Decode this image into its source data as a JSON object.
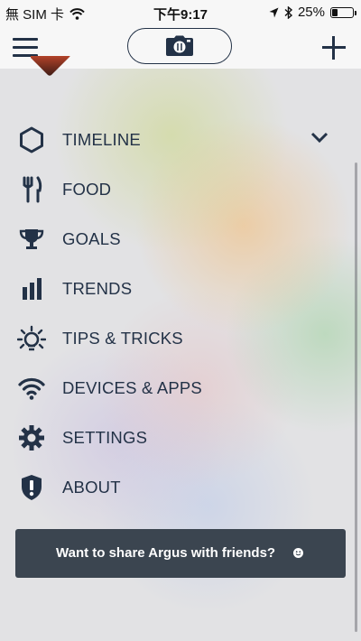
{
  "status_bar": {
    "carrier": "無 SIM 卡",
    "time": "下午9:17",
    "battery": "25%",
    "battery_level": 0.25,
    "wifi_icon": "wifi-icon",
    "location_icon": "location-arrow-icon",
    "bluetooth_icon": "bluetooth-icon"
  },
  "nav_bar": {
    "menu_icon": "hamburger-icon",
    "camera_icon": "camera-icon",
    "add_icon": "plus-icon"
  },
  "menu": {
    "items": [
      {
        "label": "TIMELINE",
        "icon": "hexagon-icon",
        "expanded": true
      },
      {
        "label": "FOOD",
        "icon": "fork-knife-icon"
      },
      {
        "label": "GOALS",
        "icon": "trophy-icon"
      },
      {
        "label": "TRENDS",
        "icon": "bar-chart-icon"
      },
      {
        "label": "TIPS & TRICKS",
        "icon": "lightbulb-icon"
      },
      {
        "label": "DEVICES & APPS",
        "icon": "wifi-icon"
      },
      {
        "label": "SETTINGS",
        "icon": "gear-icon"
      },
      {
        "label": "ABOUT",
        "icon": "shield-alert-icon"
      }
    ]
  },
  "share_banner": {
    "text": "Want to share Argus with friends?",
    "icon": "smiley-icon"
  },
  "colors": {
    "accent": "#233247",
    "banner_bg": "#3b4550"
  }
}
